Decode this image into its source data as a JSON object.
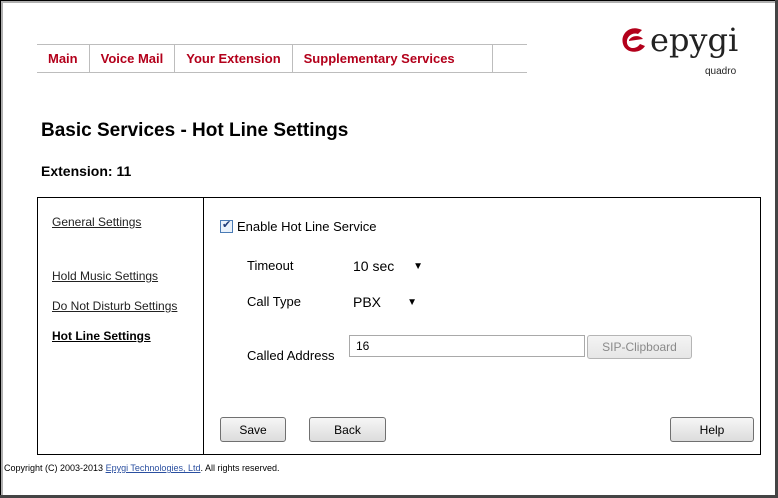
{
  "nav": {
    "items": [
      "Main",
      "Voice Mail",
      "Your Extension",
      "Supplementary Services"
    ]
  },
  "logo": {
    "brand": "epygi",
    "model": "quadro",
    "icon": "epygi-swoosh-logo",
    "color": "#b3001b"
  },
  "page": {
    "title": "Basic Services - Hot Line Settings",
    "extension_label": "Extension: 11"
  },
  "sidebar": {
    "items": [
      "General Settings",
      "Hold Music Settings",
      "Do Not Disturb Settings",
      "Hot Line Settings"
    ],
    "active": "Hot Line Settings"
  },
  "form": {
    "enable_label": "Enable Hot Line Service",
    "enable_checked": true,
    "timeout_label": "Timeout",
    "timeout_value": "10 sec",
    "call_type_label": "Call Type",
    "call_type_value": "PBX",
    "called_address_label": "Called Address",
    "called_address_value": "16",
    "sip_clipboard_label": "SIP-Clipboard"
  },
  "buttons": {
    "save": "Save",
    "back": "Back",
    "help": "Help"
  },
  "footer": {
    "prefix": "Copyright (C) 2003-2013 ",
    "link": "Epygi Technologies, Ltd",
    "suffix": ". All rights reserved."
  }
}
